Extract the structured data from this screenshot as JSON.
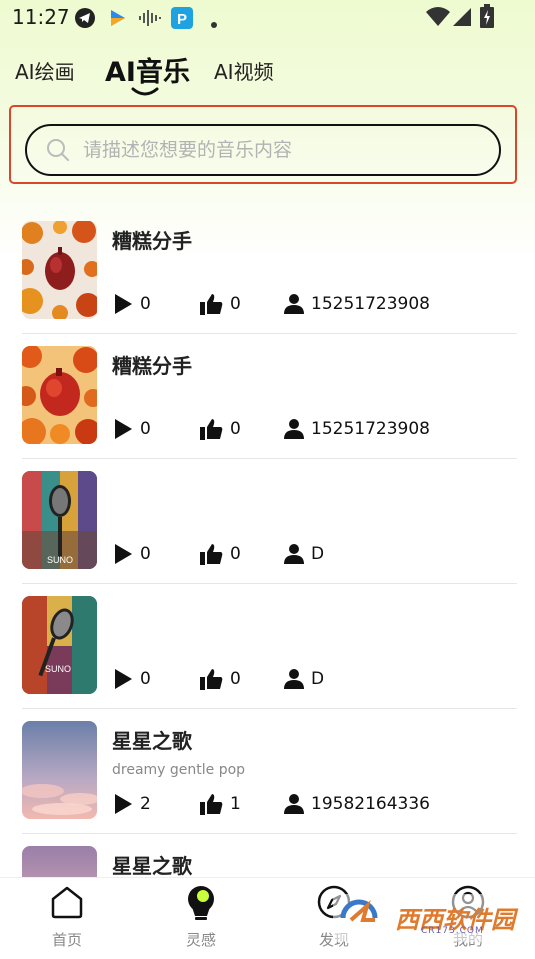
{
  "status_bar": {
    "time": "11:27",
    "left_icons": [
      "telegram-icon",
      "media-app-icon",
      "waveform-icon",
      "p-app-icon",
      "dot-icon"
    ],
    "right_icons": [
      "wifi-icon",
      "signal-icon",
      "battery-charging-icon"
    ]
  },
  "tabs": [
    {
      "label": "AI绘画",
      "active": false
    },
    {
      "label": "AI音乐",
      "active": true
    },
    {
      "label": "AI视频",
      "active": false
    }
  ],
  "search": {
    "placeholder": "请描述您想要的音乐内容"
  },
  "items": [
    {
      "title": "糟糕分手",
      "subtitle": "",
      "plays": "0",
      "likes": "0",
      "author": "15251723908",
      "cover": "autumn-heart"
    },
    {
      "title": "糟糕分手",
      "subtitle": "",
      "plays": "0",
      "likes": "0",
      "author": "15251723908",
      "cover": "autumn-heart-2"
    },
    {
      "title": "",
      "subtitle": "",
      "plays": "0",
      "likes": "0",
      "author": "D",
      "cover": "microphone",
      "cover_text": "SUNO"
    },
    {
      "title": "",
      "subtitle": "",
      "plays": "0",
      "likes": "0",
      "author": "D",
      "cover": "microphone-2",
      "cover_text": "SUNO"
    },
    {
      "title": "星星之歌",
      "subtitle": "dreamy gentle pop",
      "plays": "2",
      "likes": "1",
      "author": "19582164336",
      "cover": "sky-clouds"
    },
    {
      "title": "星星之歌",
      "subtitle": "",
      "plays": "",
      "likes": "",
      "author": "",
      "cover": "sky-clouds-2"
    }
  ],
  "bottom_nav": [
    {
      "label": "首页",
      "icon": "home-icon",
      "active": false
    },
    {
      "label": "灵感",
      "icon": "lightbulb-icon",
      "active": true
    },
    {
      "label": "发现",
      "icon": "compass-icon",
      "active": false
    },
    {
      "label": "我的",
      "icon": "user-icon",
      "active": false
    }
  ],
  "watermark": {
    "text": "西西软件园",
    "sub": "CR173.COM"
  },
  "colors": {
    "accent_border": "#d9472b",
    "header_gradient_top": "#eefbd0"
  }
}
